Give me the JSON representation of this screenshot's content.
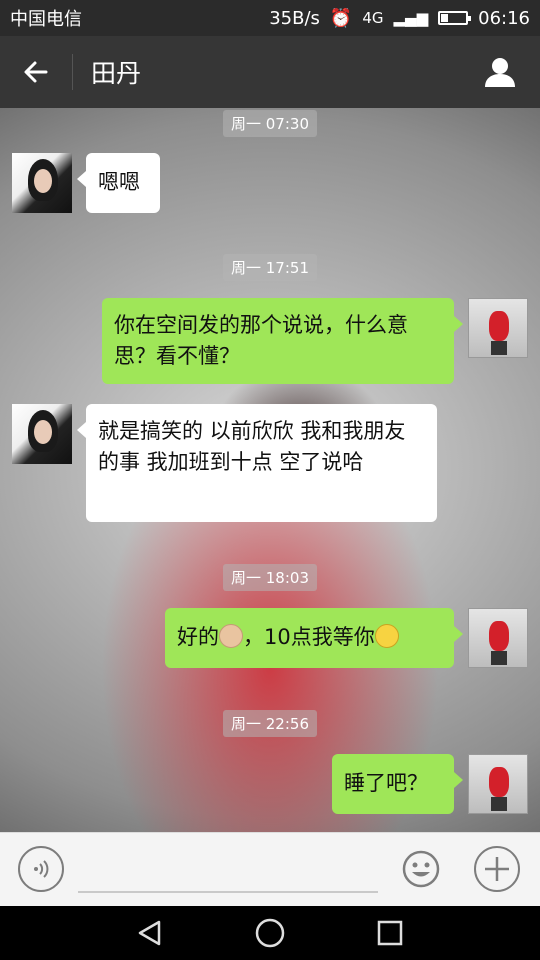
{
  "status_bar": {
    "carrier": "中国电信",
    "net_speed": "35B/s",
    "network": "4G",
    "network2": "4G 2G",
    "battery_level": 0.3,
    "time": "06:16"
  },
  "header": {
    "back_icon": "arrow-left-icon",
    "title": "田丹",
    "profile_icon": "person-icon"
  },
  "messages": {
    "t1": "周一 07:30",
    "m1": "嗯嗯",
    "t2": "周一 17:51",
    "m2": "你在空间发的那个说说，什么意思？看不懂？",
    "m3": "就是搞笑的 以前欣欣 我和我朋友的事 我加班到十点 空了说哈",
    "t3": "周一 18:03",
    "m4_a": "好的",
    "m4_b": "，10点我等你",
    "t4": "周一 22:56",
    "m5": "睡了吧？"
  },
  "input": {
    "value": "",
    "voice_icon": "voice-icon",
    "emoji_icon": "emoji-icon",
    "plus_icon": "plus-icon"
  },
  "colors": {
    "outgoing_bubble": "#9fe658",
    "incoming_bubble": "#ffffff",
    "header": "#363636"
  }
}
